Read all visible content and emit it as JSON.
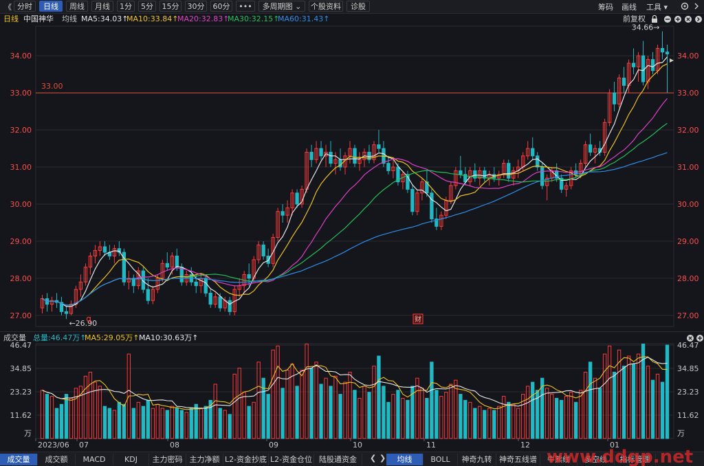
{
  "toolbar": {
    "back_glyph": "《",
    "periods": [
      "分时",
      "日线",
      "周线",
      "月线",
      "1分",
      "5分",
      "15分",
      "30分",
      "60分",
      "•••",
      "多周期图 ⌄",
      "个股资料",
      "诊股"
    ],
    "active_period": "日线",
    "right": [
      "筹码",
      "画线",
      "工具 ▾"
    ]
  },
  "legend": {
    "period": "日线",
    "stock": "中国神华",
    "ma_label": "均线",
    "items": [
      {
        "text": "MA5:34.03↑",
        "color": "#e8e8e8"
      },
      {
        "text": "MA10:33.84↑",
        "color": "#f0c419"
      },
      {
        "text": "MA20:32.83↑",
        "color": "#e040c8"
      },
      {
        "text": "MA30:32.15↑",
        "color": "#21c05a"
      },
      {
        "text": "MA60:31.43↑",
        "color": "#2e8ee8"
      }
    ],
    "adjust": "前复权"
  },
  "volume_legend": {
    "title": "成交量",
    "items": [
      {
        "text": "总量:46.47万↑",
        "color": "#25b9c8"
      },
      {
        "text": "MA5:29.05万↑",
        "color": "#f0c419"
      },
      {
        "text": "MA10:30.63万↑",
        "color": "#e8e8e8"
      }
    ]
  },
  "bottom_tabs_left": [
    "成交量",
    "成交额",
    "MACD",
    "KDJ",
    "主力密码",
    "主力净额",
    "L2-资金抄底",
    "L2-资金仓位",
    "陆股通资金"
  ],
  "bottom_tabs_right": [
    "均线",
    "BOLL",
    "神奇九转",
    "神奇五线谱",
    "牛熊线",
    "多空线",
    "指标管理"
  ],
  "bottom_active_left": "成交量",
  "bottom_active_right": "均线",
  "watermark": "www.ddgp.net",
  "colors": {
    "up": "#ff3b3b",
    "down": "#22b8c4",
    "bg": "#15161b",
    "grid": "#2a2b30",
    "price_axis": "#ff4d4d",
    "ref_line": "#e0503a"
  },
  "chart_data": {
    "type": "candlestick",
    "price_axis": {
      "ticks": [
        27.0,
        28.0,
        29.0,
        30.0,
        31.0,
        32.0,
        33.0,
        34.0
      ],
      "ylim": [
        26.7,
        34.8
      ]
    },
    "volume_axis": {
      "ticks": [
        "46.47",
        "34.85",
        "23.23",
        "11.62"
      ],
      "unit": "万",
      "ylim": [
        0,
        46.47
      ]
    },
    "x_labels": [
      "2023/06",
      "07",
      "08",
      "09",
      "10",
      "11",
      "12",
      "01"
    ],
    "reference_line": {
      "value": 33.0,
      "label": "33.00"
    },
    "annotations": [
      {
        "text": "34.66→",
        "kind": "high"
      },
      {
        "text": "←26.90",
        "kind": "low"
      },
      {
        "text": "q",
        "kind": "marker"
      },
      {
        "text": "财",
        "kind": "marker"
      }
    ],
    "candles": [
      {
        "o": 27.2,
        "h": 27.55,
        "l": 27.05,
        "c": 27.45,
        "v": 24
      },
      {
        "o": 27.45,
        "h": 27.6,
        "l": 27.1,
        "c": 27.3,
        "v": 22
      },
      {
        "o": 27.3,
        "h": 27.5,
        "l": 27.1,
        "c": 27.4,
        "v": 21
      },
      {
        "o": 27.4,
        "h": 27.6,
        "l": 27.2,
        "c": 27.35,
        "v": 15
      },
      {
        "o": 27.35,
        "h": 27.5,
        "l": 27.0,
        "c": 27.1,
        "v": 17
      },
      {
        "o": 27.1,
        "h": 27.25,
        "l": 26.9,
        "c": 27.05,
        "v": 22
      },
      {
        "o": 27.05,
        "h": 27.4,
        "l": 27.0,
        "c": 27.3,
        "v": 20
      },
      {
        "o": 27.3,
        "h": 27.8,
        "l": 27.2,
        "c": 27.7,
        "v": 25
      },
      {
        "o": 27.7,
        "h": 28.1,
        "l": 27.5,
        "c": 27.9,
        "v": 26
      },
      {
        "o": 27.9,
        "h": 28.4,
        "l": 27.8,
        "c": 28.3,
        "v": 31
      },
      {
        "o": 28.3,
        "h": 28.7,
        "l": 28.1,
        "c": 28.6,
        "v": 33
      },
      {
        "o": 28.6,
        "h": 28.9,
        "l": 28.4,
        "c": 28.75,
        "v": 28
      },
      {
        "o": 28.75,
        "h": 29.0,
        "l": 28.6,
        "c": 28.85,
        "v": 26
      },
      {
        "o": 28.85,
        "h": 29.0,
        "l": 28.6,
        "c": 28.7,
        "v": 16
      },
      {
        "o": 28.7,
        "h": 28.9,
        "l": 28.5,
        "c": 28.6,
        "v": 15
      },
      {
        "o": 28.6,
        "h": 28.9,
        "l": 28.4,
        "c": 28.8,
        "v": 14
      },
      {
        "o": 28.8,
        "h": 29.0,
        "l": 28.6,
        "c": 28.7,
        "v": 18
      },
      {
        "o": 28.7,
        "h": 28.8,
        "l": 27.8,
        "c": 27.9,
        "v": 17
      },
      {
        "o": 27.9,
        "h": 28.2,
        "l": 27.7,
        "c": 28.0,
        "v": 42
      },
      {
        "o": 28.0,
        "h": 28.1,
        "l": 27.6,
        "c": 27.8,
        "v": 15
      },
      {
        "o": 27.8,
        "h": 28.3,
        "l": 27.7,
        "c": 28.2,
        "v": 18
      },
      {
        "o": 28.2,
        "h": 28.3,
        "l": 27.6,
        "c": 27.7,
        "v": 16
      },
      {
        "o": 27.7,
        "h": 28.0,
        "l": 27.3,
        "c": 27.4,
        "v": 19
      },
      {
        "o": 27.4,
        "h": 27.8,
        "l": 27.3,
        "c": 27.7,
        "v": 15
      },
      {
        "o": 27.7,
        "h": 28.1,
        "l": 27.6,
        "c": 28.0,
        "v": 17
      },
      {
        "o": 28.0,
        "h": 28.5,
        "l": 27.9,
        "c": 28.4,
        "v": 15
      },
      {
        "o": 28.4,
        "h": 28.7,
        "l": 28.2,
        "c": 28.3,
        "v": 14
      },
      {
        "o": 28.3,
        "h": 28.7,
        "l": 28.1,
        "c": 28.6,
        "v": 16
      },
      {
        "o": 28.6,
        "h": 28.8,
        "l": 28.2,
        "c": 28.3,
        "v": 15
      },
      {
        "o": 28.3,
        "h": 28.4,
        "l": 27.8,
        "c": 27.9,
        "v": 14
      },
      {
        "o": 27.9,
        "h": 28.2,
        "l": 27.8,
        "c": 28.1,
        "v": 13
      },
      {
        "o": 28.1,
        "h": 28.3,
        "l": 27.8,
        "c": 27.9,
        "v": 15
      },
      {
        "o": 27.9,
        "h": 28.1,
        "l": 27.6,
        "c": 27.8,
        "v": 17
      },
      {
        "o": 27.8,
        "h": 28.1,
        "l": 27.6,
        "c": 28.0,
        "v": 15
      },
      {
        "o": 28.0,
        "h": 28.1,
        "l": 27.5,
        "c": 27.6,
        "v": 16
      },
      {
        "o": 27.6,
        "h": 27.7,
        "l": 27.2,
        "c": 27.3,
        "v": 19
      },
      {
        "o": 27.3,
        "h": 27.6,
        "l": 27.2,
        "c": 27.5,
        "v": 27
      },
      {
        "o": 27.5,
        "h": 27.6,
        "l": 27.1,
        "c": 27.2,
        "v": 15
      },
      {
        "o": 27.2,
        "h": 27.5,
        "l": 27.1,
        "c": 27.4,
        "v": 14
      },
      {
        "o": 27.4,
        "h": 27.5,
        "l": 27.0,
        "c": 27.1,
        "v": 12
      },
      {
        "o": 27.1,
        "h": 27.8,
        "l": 27.0,
        "c": 27.7,
        "v": 32
      },
      {
        "o": 27.7,
        "h": 28.0,
        "l": 27.5,
        "c": 27.8,
        "v": 35
      },
      {
        "o": 27.8,
        "h": 28.2,
        "l": 27.6,
        "c": 28.1,
        "v": 23
      },
      {
        "o": 28.1,
        "h": 28.4,
        "l": 27.8,
        "c": 28.0,
        "v": 16
      },
      {
        "o": 28.0,
        "h": 28.6,
        "l": 27.9,
        "c": 28.5,
        "v": 18
      },
      {
        "o": 28.5,
        "h": 29.0,
        "l": 28.4,
        "c": 28.9,
        "v": 38
      },
      {
        "o": 28.9,
        "h": 29.0,
        "l": 28.5,
        "c": 28.6,
        "v": 30
      },
      {
        "o": 28.6,
        "h": 28.8,
        "l": 28.3,
        "c": 28.4,
        "v": 22
      },
      {
        "o": 28.4,
        "h": 29.2,
        "l": 28.3,
        "c": 29.1,
        "v": 44
      },
      {
        "o": 29.1,
        "h": 29.9,
        "l": 29.0,
        "c": 29.8,
        "v": 46
      },
      {
        "o": 29.8,
        "h": 30.0,
        "l": 29.5,
        "c": 29.7,
        "v": 25
      },
      {
        "o": 29.7,
        "h": 30.1,
        "l": 29.5,
        "c": 29.9,
        "v": 34
      },
      {
        "o": 29.9,
        "h": 30.4,
        "l": 29.7,
        "c": 30.3,
        "v": 37
      },
      {
        "o": 30.3,
        "h": 30.4,
        "l": 29.9,
        "c": 30.0,
        "v": 26
      },
      {
        "o": 30.0,
        "h": 30.5,
        "l": 29.9,
        "c": 30.4,
        "v": 34
      },
      {
        "o": 30.4,
        "h": 31.5,
        "l": 30.3,
        "c": 31.4,
        "v": 47
      },
      {
        "o": 31.4,
        "h": 31.6,
        "l": 31.0,
        "c": 31.2,
        "v": 35
      },
      {
        "o": 31.2,
        "h": 31.7,
        "l": 31.1,
        "c": 31.5,
        "v": 38
      },
      {
        "o": 31.5,
        "h": 31.7,
        "l": 31.2,
        "c": 31.3,
        "v": 27
      },
      {
        "o": 31.3,
        "h": 31.6,
        "l": 31.0,
        "c": 31.4,
        "v": 30
      },
      {
        "o": 31.4,
        "h": 31.7,
        "l": 31.0,
        "c": 31.1,
        "v": 26
      },
      {
        "o": 31.1,
        "h": 31.4,
        "l": 30.8,
        "c": 31.2,
        "v": 31
      },
      {
        "o": 31.2,
        "h": 31.5,
        "l": 30.9,
        "c": 31.0,
        "v": 22
      },
      {
        "o": 31.0,
        "h": 31.4,
        "l": 30.8,
        "c": 31.3,
        "v": 28
      },
      {
        "o": 31.3,
        "h": 31.7,
        "l": 31.1,
        "c": 31.5,
        "v": 33
      },
      {
        "o": 31.5,
        "h": 31.6,
        "l": 31.0,
        "c": 31.1,
        "v": 24
      },
      {
        "o": 31.1,
        "h": 31.4,
        "l": 30.9,
        "c": 31.2,
        "v": 20
      },
      {
        "o": 31.2,
        "h": 31.5,
        "l": 31.0,
        "c": 31.4,
        "v": 26
      },
      {
        "o": 31.4,
        "h": 31.6,
        "l": 31.1,
        "c": 31.2,
        "v": 23
      },
      {
        "o": 31.2,
        "h": 31.7,
        "l": 31.1,
        "c": 31.6,
        "v": 36
      },
      {
        "o": 31.6,
        "h": 32.0,
        "l": 31.4,
        "c": 31.5,
        "v": 41
      },
      {
        "o": 31.5,
        "h": 31.7,
        "l": 31.0,
        "c": 31.1,
        "v": 26
      },
      {
        "o": 31.1,
        "h": 31.3,
        "l": 30.8,
        "c": 30.9,
        "v": 18
      },
      {
        "o": 30.9,
        "h": 31.2,
        "l": 30.7,
        "c": 31.0,
        "v": 22
      },
      {
        "o": 31.0,
        "h": 31.1,
        "l": 30.5,
        "c": 30.6,
        "v": 24
      },
      {
        "o": 30.6,
        "h": 30.9,
        "l": 30.4,
        "c": 30.8,
        "v": 20
      },
      {
        "o": 30.8,
        "h": 30.9,
        "l": 30.3,
        "c": 30.4,
        "v": 19
      },
      {
        "o": 30.4,
        "h": 30.5,
        "l": 29.7,
        "c": 29.8,
        "v": 26
      },
      {
        "o": 29.8,
        "h": 30.4,
        "l": 29.7,
        "c": 30.3,
        "v": 30
      },
      {
        "o": 30.3,
        "h": 30.7,
        "l": 30.1,
        "c": 30.6,
        "v": 25
      },
      {
        "o": 30.6,
        "h": 30.9,
        "l": 30.2,
        "c": 30.3,
        "v": 20
      },
      {
        "o": 30.3,
        "h": 30.4,
        "l": 29.5,
        "c": 29.6,
        "v": 38
      },
      {
        "o": 29.6,
        "h": 29.9,
        "l": 29.3,
        "c": 29.4,
        "v": 24
      },
      {
        "o": 29.4,
        "h": 29.8,
        "l": 29.3,
        "c": 29.7,
        "v": 21
      },
      {
        "o": 29.7,
        "h": 30.2,
        "l": 29.6,
        "c": 30.1,
        "v": 23
      },
      {
        "o": 30.1,
        "h": 30.6,
        "l": 30.0,
        "c": 30.5,
        "v": 27
      },
      {
        "o": 30.5,
        "h": 31.0,
        "l": 30.4,
        "c": 30.9,
        "v": 29
      },
      {
        "o": 30.9,
        "h": 31.3,
        "l": 30.7,
        "c": 30.8,
        "v": 22
      },
      {
        "o": 30.8,
        "h": 31.0,
        "l": 30.5,
        "c": 30.6,
        "v": 19
      },
      {
        "o": 30.6,
        "h": 31.0,
        "l": 30.5,
        "c": 30.9,
        "v": 18
      },
      {
        "o": 30.9,
        "h": 31.1,
        "l": 30.6,
        "c": 30.7,
        "v": 15
      },
      {
        "o": 30.7,
        "h": 31.0,
        "l": 30.5,
        "c": 30.9,
        "v": 16
      },
      {
        "o": 30.9,
        "h": 31.0,
        "l": 30.6,
        "c": 30.7,
        "v": 14
      },
      {
        "o": 30.7,
        "h": 30.9,
        "l": 30.5,
        "c": 30.8,
        "v": 15
      },
      {
        "o": 30.8,
        "h": 31.0,
        "l": 30.6,
        "c": 30.7,
        "v": 14
      },
      {
        "o": 30.7,
        "h": 30.9,
        "l": 30.5,
        "c": 30.8,
        "v": 16
      },
      {
        "o": 30.8,
        "h": 31.2,
        "l": 30.7,
        "c": 31.1,
        "v": 21
      },
      {
        "o": 31.1,
        "h": 31.2,
        "l": 30.6,
        "c": 30.7,
        "v": 18
      },
      {
        "o": 30.7,
        "h": 31.0,
        "l": 30.5,
        "c": 30.9,
        "v": 17
      },
      {
        "o": 30.9,
        "h": 31.2,
        "l": 30.7,
        "c": 31.0,
        "v": 15
      },
      {
        "o": 31.0,
        "h": 31.4,
        "l": 30.9,
        "c": 31.3,
        "v": 22
      },
      {
        "o": 31.3,
        "h": 31.7,
        "l": 31.2,
        "c": 31.5,
        "v": 26
      },
      {
        "o": 31.5,
        "h": 31.8,
        "l": 31.2,
        "c": 31.3,
        "v": 28
      },
      {
        "o": 31.3,
        "h": 31.4,
        "l": 30.9,
        "c": 31.0,
        "v": 24
      },
      {
        "o": 31.0,
        "h": 31.1,
        "l": 30.4,
        "c": 30.5,
        "v": 30
      },
      {
        "o": 30.5,
        "h": 30.8,
        "l": 30.1,
        "c": 30.7,
        "v": 25
      },
      {
        "o": 30.7,
        "h": 31.0,
        "l": 30.6,
        "c": 30.9,
        "v": 22
      },
      {
        "o": 30.9,
        "h": 31.1,
        "l": 30.6,
        "c": 30.7,
        "v": 20
      },
      {
        "o": 30.7,
        "h": 30.8,
        "l": 30.3,
        "c": 30.4,
        "v": 19
      },
      {
        "o": 30.4,
        "h": 30.6,
        "l": 30.2,
        "c": 30.5,
        "v": 21
      },
      {
        "o": 30.5,
        "h": 31.0,
        "l": 30.4,
        "c": 30.9,
        "v": 23
      },
      {
        "o": 30.9,
        "h": 31.1,
        "l": 30.7,
        "c": 30.8,
        "v": 18
      },
      {
        "o": 30.8,
        "h": 31.2,
        "l": 30.7,
        "c": 31.1,
        "v": 24
      },
      {
        "o": 31.1,
        "h": 31.7,
        "l": 31.0,
        "c": 31.6,
        "v": 33
      },
      {
        "o": 31.6,
        "h": 31.9,
        "l": 31.3,
        "c": 31.4,
        "v": 38
      },
      {
        "o": 31.4,
        "h": 31.6,
        "l": 31.1,
        "c": 31.5,
        "v": 30
      },
      {
        "o": 31.5,
        "h": 31.7,
        "l": 31.3,
        "c": 31.4,
        "v": 25
      },
      {
        "o": 31.4,
        "h": 32.3,
        "l": 31.3,
        "c": 32.2,
        "v": 42
      },
      {
        "o": 32.2,
        "h": 33.1,
        "l": 32.1,
        "c": 33.0,
        "v": 46
      },
      {
        "o": 33.0,
        "h": 33.3,
        "l": 32.5,
        "c": 32.7,
        "v": 33
      },
      {
        "o": 32.7,
        "h": 33.5,
        "l": 32.6,
        "c": 33.4,
        "v": 44
      },
      {
        "o": 33.4,
        "h": 33.7,
        "l": 33.0,
        "c": 33.2,
        "v": 36
      },
      {
        "o": 33.2,
        "h": 33.9,
        "l": 33.0,
        "c": 33.8,
        "v": 41
      },
      {
        "o": 33.8,
        "h": 34.2,
        "l": 33.5,
        "c": 33.7,
        "v": 37
      },
      {
        "o": 33.7,
        "h": 34.1,
        "l": 33.3,
        "c": 34.0,
        "v": 42
      },
      {
        "o": 34.0,
        "h": 34.4,
        "l": 33.2,
        "c": 33.3,
        "v": 47
      },
      {
        "o": 33.3,
        "h": 34.0,
        "l": 33.1,
        "c": 33.9,
        "v": 36
      },
      {
        "o": 33.9,
        "h": 34.1,
        "l": 33.5,
        "c": 33.6,
        "v": 29
      },
      {
        "o": 33.6,
        "h": 34.3,
        "l": 33.5,
        "c": 34.2,
        "v": 32
      },
      {
        "o": 34.2,
        "h": 34.66,
        "l": 33.9,
        "c": 34.1,
        "v": 28
      },
      {
        "o": 34.1,
        "h": 34.3,
        "l": 33.0,
        "c": 34.05,
        "v": 46.47
      }
    ]
  }
}
